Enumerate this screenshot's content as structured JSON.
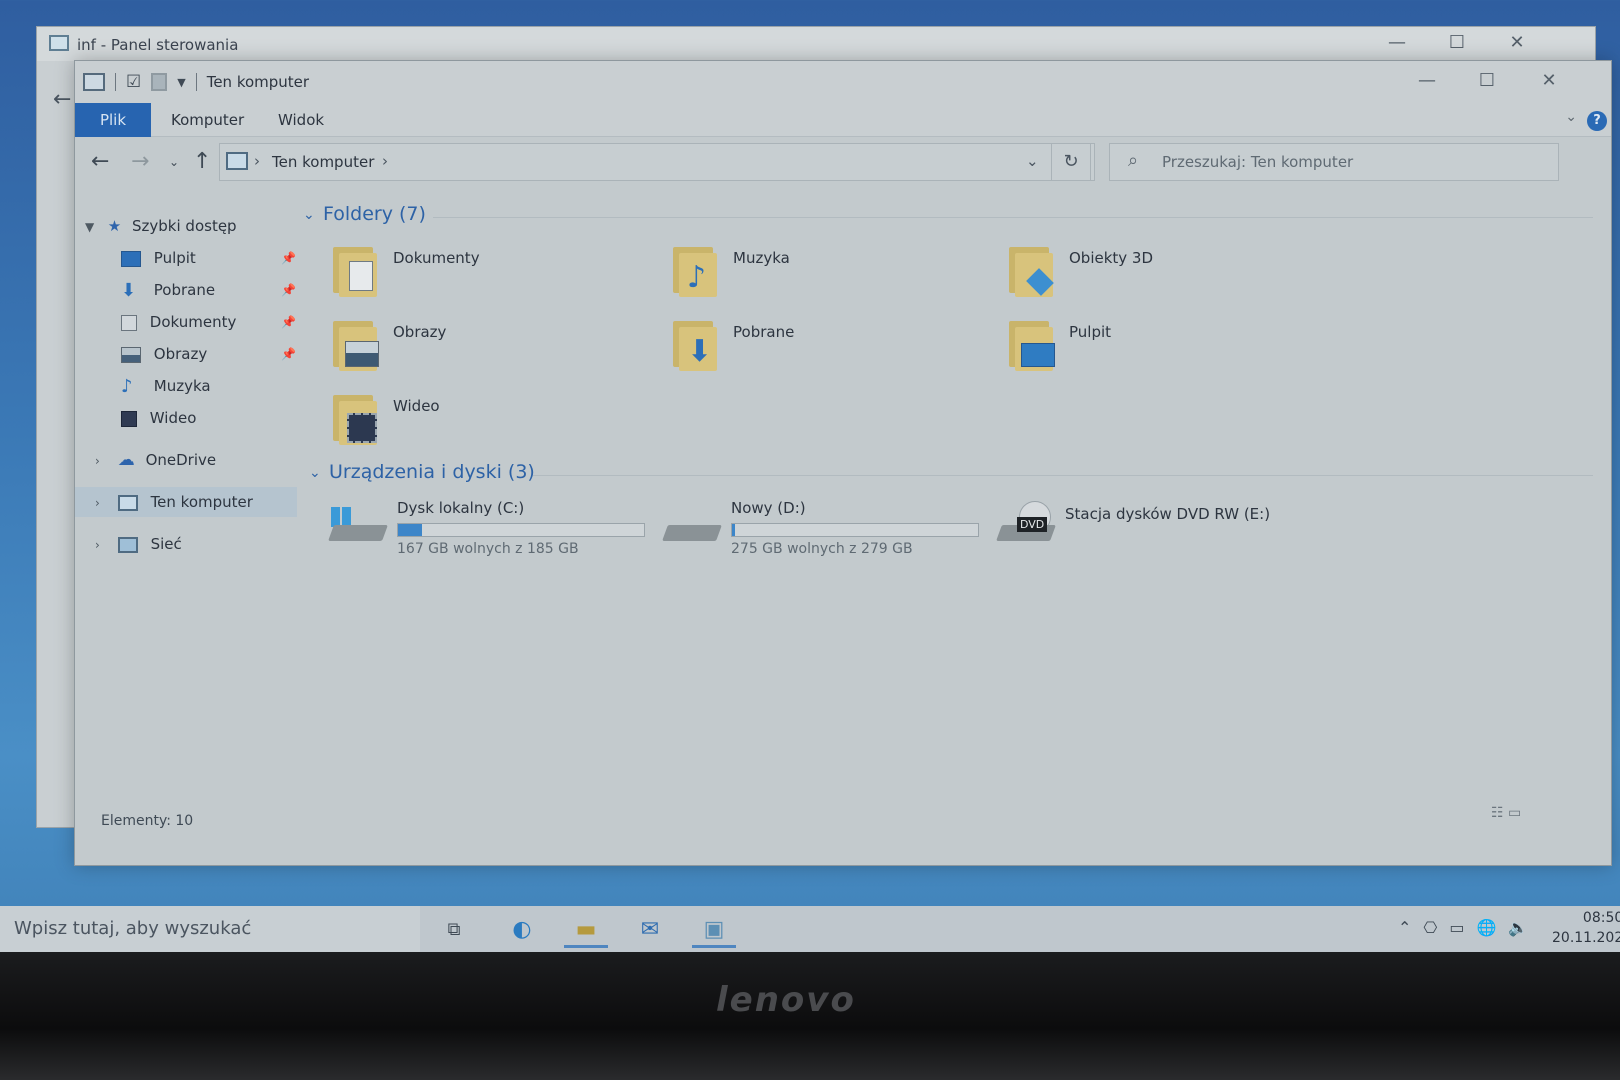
{
  "control_panel": {
    "title": "inf - Panel sterowania"
  },
  "explorer": {
    "title": "Ten komputer",
    "ribbon_tabs": [
      "Plik",
      "Komputer",
      "Widok"
    ],
    "address": "Ten komputer",
    "search_placeholder": "Przeszukaj: Ten komputer",
    "nav": {
      "quick_access": "Szybki dostęp",
      "items": [
        "Pulpit",
        "Pobrane",
        "Dokumenty",
        "Obrazy",
        "Muzyka",
        "Wideo"
      ],
      "onedrive": "OneDrive",
      "this_pc": "Ten komputer",
      "network": "Sieć"
    },
    "folders_header": "Foldery (7)",
    "folders": [
      "Dokumenty",
      "Muzyka",
      "Obiekty 3D",
      "Obrazy",
      "Pobrane",
      "Pulpit",
      "Wideo"
    ],
    "devices_header": "Urządzenia i dyski (3)",
    "drives": [
      {
        "name": "Dysk lokalny (C:)",
        "free": "167 GB wolnych z 185 GB",
        "used_fraction": 0.097
      },
      {
        "name": "Nowy (D:)",
        "free": "275 GB wolnych z 279 GB",
        "used_fraction": 0.014
      },
      {
        "name": "Stacja dysków DVD RW (E:)",
        "badge": "DVD"
      }
    ],
    "status": "Elementy: 10"
  },
  "taskbar": {
    "search_placeholder": "Wpisz tutaj, aby wyszukać",
    "time": "08:50",
    "date": "20.11.202"
  },
  "bezel": {
    "brand": "lenovo"
  },
  "colors": {
    "accent": "#2764b0",
    "drive_fill": "#3d86c9",
    "group_header": "#2d62a6"
  }
}
